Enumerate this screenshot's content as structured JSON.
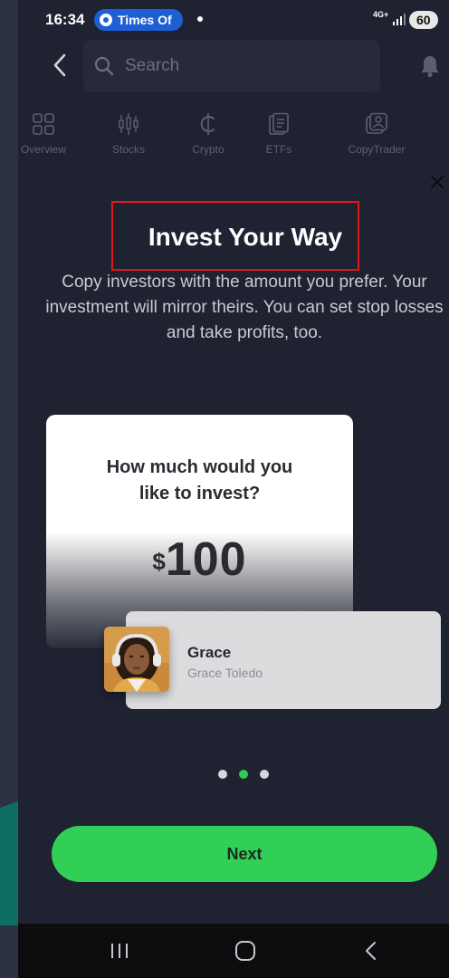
{
  "status_bar": {
    "time": "16:34",
    "notification_pill": "Times Of",
    "network": "4G+",
    "battery": "60"
  },
  "search": {
    "placeholder": "Search"
  },
  "tabs": [
    {
      "label": "Overview",
      "icon": "grid-icon"
    },
    {
      "label": "Stocks",
      "icon": "candlestick-icon"
    },
    {
      "label": "Crypto",
      "icon": "crypto-icon"
    },
    {
      "label": "ETFs",
      "icon": "document-icon"
    },
    {
      "label": "CopyTrader",
      "icon": "copytrader-icon"
    }
  ],
  "onboarding": {
    "title": "Invest Your Way",
    "description": "Copy investors with the amount you prefer. Your investment will mirror theirs. You can set stop losses and take profits, too.",
    "card": {
      "question": "How much would you like to invest?",
      "currency": "$",
      "amount": "100"
    },
    "investor": {
      "name": "Grace",
      "full_name": "Grace Toledo"
    },
    "pager": {
      "count": 3,
      "active_index": 1
    },
    "next_label": "Next"
  },
  "colors": {
    "accent_green": "#31cf55",
    "panel_bg": "#1f2231",
    "highlight_box": "#e01818"
  }
}
